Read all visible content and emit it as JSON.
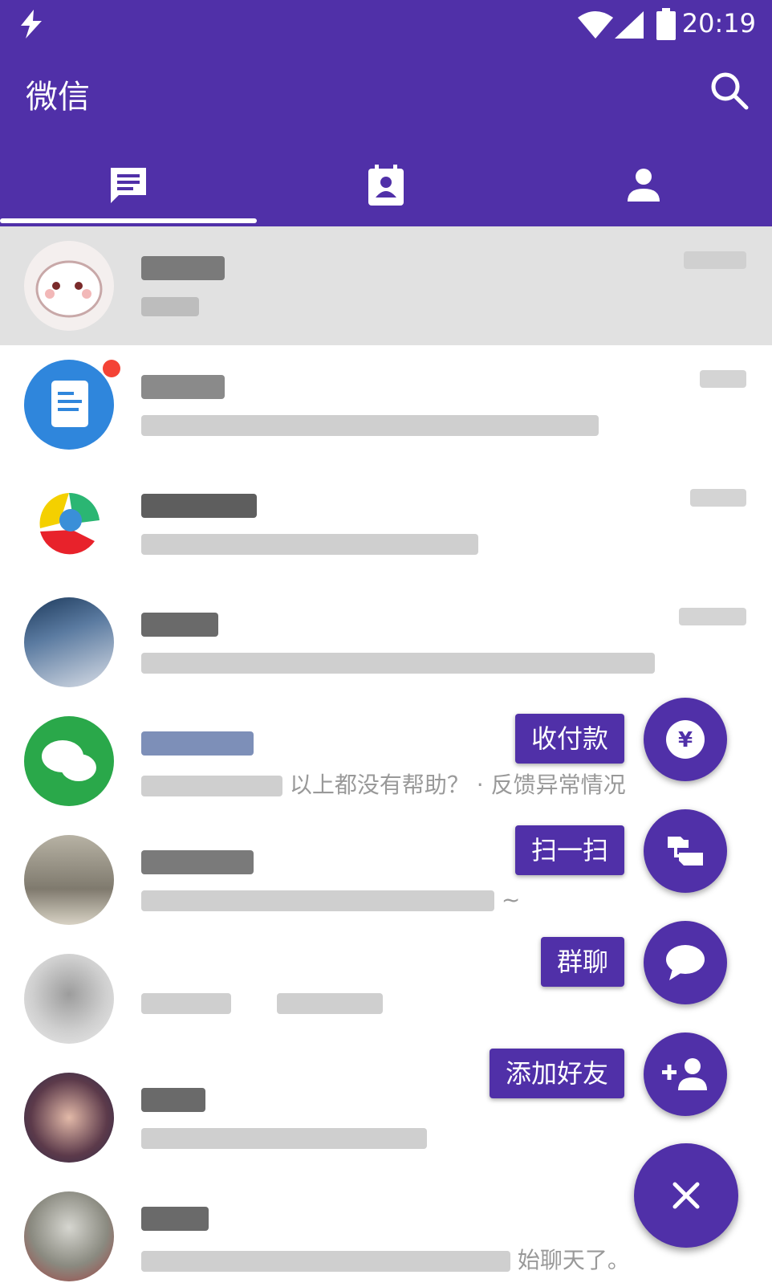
{
  "status_bar": {
    "time": "20:19"
  },
  "app": {
    "title": "微信",
    "accent": "#5030a8"
  },
  "tabs": [
    {
      "name": "chats",
      "icon": "chat-icon",
      "selected": true
    },
    {
      "name": "contacts",
      "icon": "contact-card-icon",
      "selected": false
    },
    {
      "name": "me",
      "icon": "person-icon",
      "selected": false
    }
  ],
  "conversations": [
    {
      "avatar": "cat-sticker-avatar",
      "pressed": true
    },
    {
      "avatar": "document-app-avatar",
      "unread_dot": true
    },
    {
      "avatar": "colorful-logo-avatar"
    },
    {
      "avatar": "photo-avatar-1"
    },
    {
      "avatar": "wechat-green-avatar",
      "message_tail": "以上都没有帮助？ · 反馈异常情况"
    },
    {
      "avatar": "photo-avatar-2",
      "message_tail": "~"
    },
    {
      "avatar": "photo-avatar-3"
    },
    {
      "avatar": "photo-avatar-4"
    },
    {
      "avatar": "photo-avatar-5",
      "message_tail": "始聊天了。"
    }
  ],
  "speed_dial": {
    "actions": [
      {
        "label": "收付款",
        "icon": "yuan-icon"
      },
      {
        "label": "扫一扫",
        "icon": "scan-icon"
      },
      {
        "label": "群聊",
        "icon": "chat-bubble-icon"
      },
      {
        "label": "添加好友",
        "icon": "add-person-icon"
      }
    ],
    "close_icon": "close-icon"
  }
}
